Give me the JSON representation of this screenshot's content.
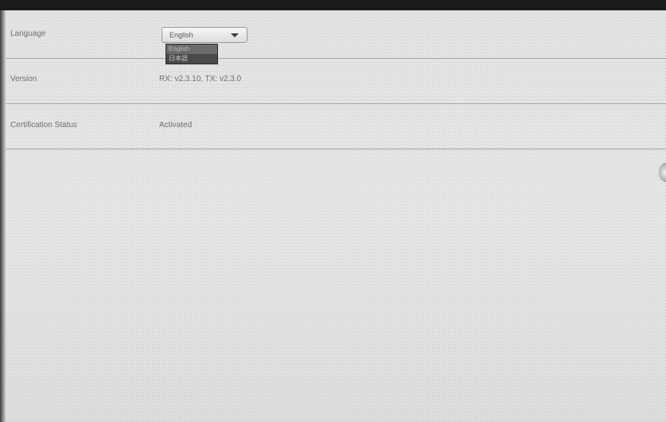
{
  "settings": {
    "language": {
      "label": "Language",
      "selected": "English",
      "options": [
        "English",
        "日本語"
      ]
    },
    "version": {
      "label": "Version",
      "value": "RX: v2.3.10, TX: v2.3.0"
    },
    "certification": {
      "label": "Certification Status",
      "value": "Activated"
    }
  },
  "icons": {
    "dropdown": "chevron-down-icon",
    "side_handle": "side-handle-icon"
  },
  "colors": {
    "background": "#e4e4e4",
    "text": "#6e6e6e",
    "divider": "#a8a8a8",
    "dropdown_bg": "#555555"
  }
}
